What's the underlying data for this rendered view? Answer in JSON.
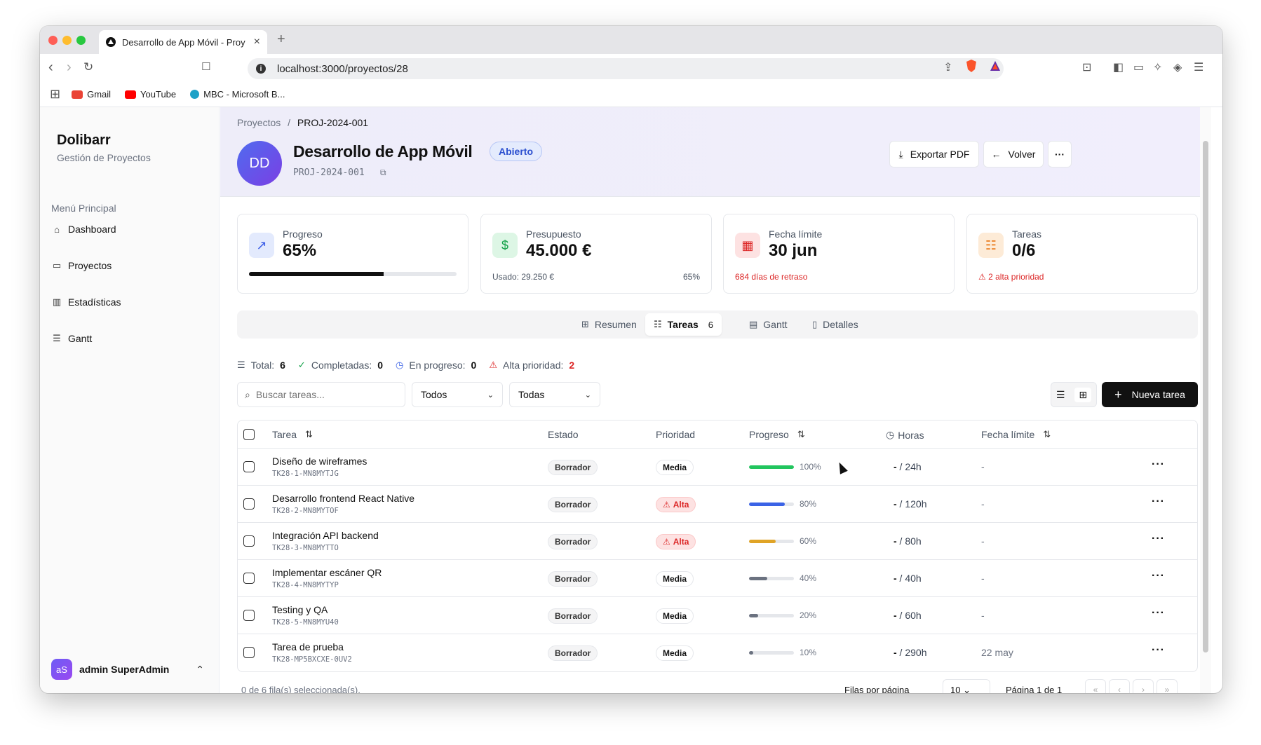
{
  "browser": {
    "tab_title": "Desarrollo de App Móvil - Proy",
    "url": "localhost:3000/proyectos/28",
    "bookmarks": [
      {
        "label": "Gmail",
        "color": "#ea4335"
      },
      {
        "label": "YouTube",
        "color": "#ff0000"
      },
      {
        "label": "MBC - Microsoft B...",
        "color": "#1da1c7"
      }
    ]
  },
  "sidebar": {
    "brand": "Dolibarr",
    "subtitle": "Gestión de Proyectos",
    "menu_label": "Menú Principal",
    "items": [
      {
        "label": "Dashboard",
        "icon": "home-icon"
      },
      {
        "label": "Proyectos",
        "icon": "folder-icon"
      },
      {
        "label": "Estadísticas",
        "icon": "bar-chart-icon"
      },
      {
        "label": "Gantt",
        "icon": "gantt-icon"
      }
    ],
    "user": {
      "initials": "aS",
      "name": "admin SuperAdmin"
    }
  },
  "header": {
    "breadcrumb": {
      "root": "Proyectos",
      "separator": "/",
      "current": "PROJ-2024-001"
    },
    "avatar": "DD",
    "title": "Desarrollo de App Móvil",
    "status": "Abierto",
    "code": "PROJ-2024-001",
    "export_label": "Exportar PDF",
    "back_label": "Volver"
  },
  "stats": {
    "progress": {
      "label": "Progreso",
      "value": "65%",
      "fraction": 0.65
    },
    "budget": {
      "label": "Presupuesto",
      "value": "45.000 €",
      "used": "Usado: 29.250 €",
      "pct": "65%"
    },
    "deadline": {
      "label": "Fecha límite",
      "value": "30 jun",
      "note": "684 días de retraso"
    },
    "tasks": {
      "label": "Tareas",
      "value": "0/6",
      "note": "2 alta prioridad"
    }
  },
  "tabs": [
    {
      "label": "Resumen",
      "icon": "grid-icon"
    },
    {
      "label": "Tareas",
      "icon": "list-check-icon",
      "count": "6"
    },
    {
      "label": "Gantt",
      "icon": "gantt-icon"
    },
    {
      "label": "Detalles",
      "icon": "document-icon"
    }
  ],
  "summary": {
    "total_label": "Total:",
    "total": "6",
    "done_label": "Completadas:",
    "done": "0",
    "progress_label": "En progreso:",
    "progress": "0",
    "high_label": "Alta prioridad:",
    "high": "2"
  },
  "filters": {
    "search_placeholder": "Buscar tareas...",
    "state_value": "Todos",
    "priority_value": "Todas",
    "new_task_label": "Nueva tarea"
  },
  "table": {
    "columns": {
      "task": "Tarea",
      "state": "Estado",
      "priority": "Prioridad",
      "progress": "Progreso",
      "hours": "Horas",
      "due": "Fecha límite"
    },
    "rows": [
      {
        "name": "Diseño de wireframes",
        "code": "TK28-1-MN8MYTJG",
        "state": "Borrador",
        "priority": "Media",
        "progress": 1.0,
        "progress_label": "100%",
        "bar_color": "#22c55e",
        "hours_done": "-",
        "hours_total": " / 24h",
        "due": "-"
      },
      {
        "name": "Desarrollo frontend React Native",
        "code": "TK28-2-MN8MYTOF",
        "state": "Borrador",
        "priority": "Alta",
        "progress": 0.8,
        "progress_label": "80%",
        "bar_color": "#3b63e6",
        "hours_done": "-",
        "hours_total": " / 120h",
        "due": "-"
      },
      {
        "name": "Integración API backend",
        "code": "TK28-3-MN8MYTTO",
        "state": "Borrador",
        "priority": "Alta",
        "progress": 0.6,
        "progress_label": "60%",
        "bar_color": "#e0a426",
        "hours_done": "-",
        "hours_total": " / 80h",
        "due": "-"
      },
      {
        "name": "Implementar escáner QR",
        "code": "TK28-4-MN8MYTYP",
        "state": "Borrador",
        "priority": "Media",
        "progress": 0.4,
        "progress_label": "40%",
        "bar_color": "#6b7280",
        "hours_done": "-",
        "hours_total": " / 40h",
        "due": "-"
      },
      {
        "name": "Testing y QA",
        "code": "TK28-5-MN8MYU40",
        "state": "Borrador",
        "priority": "Media",
        "progress": 0.2,
        "progress_label": "20%",
        "bar_color": "#6b7280",
        "hours_done": "-",
        "hours_total": " / 60h",
        "due": "-"
      },
      {
        "name": "Tarea de prueba",
        "code": "TK28-MP5BXCXE-0UV2",
        "state": "Borrador",
        "priority": "Media",
        "progress": 0.1,
        "progress_label": "10%",
        "bar_color": "#6b7280",
        "hours_done": "-",
        "hours_total": " / 290h",
        "due": "22 may"
      }
    ]
  },
  "footer": {
    "selected": "0 de 6 fila(s) seleccionada(s).",
    "rows_per_page_label": "Filas por página",
    "rows_per_page": "10",
    "page_info": "Página 1 de 1"
  }
}
